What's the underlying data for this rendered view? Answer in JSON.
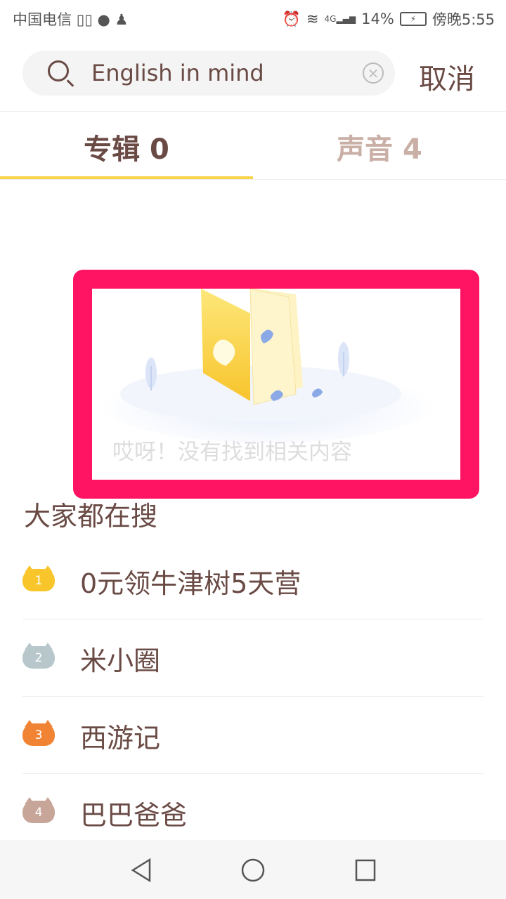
{
  "status_bar": {
    "carrier": "中国电信",
    "app_icons": [
      "ting-icon",
      "cat-icon",
      "qq-penguin-icon"
    ],
    "network": "4G",
    "battery": "14%",
    "time": "傍晚5:55"
  },
  "search": {
    "value": "English in mind",
    "cancel_label": "取消"
  },
  "tabs": [
    {
      "label": "专辑 0",
      "active": true
    },
    {
      "label": "声音 4",
      "active": false
    }
  ],
  "empty_state": {
    "message": "哎呀！没有找到相关内容"
  },
  "hot_searches": {
    "title": "大家都在搜",
    "items": [
      {
        "rank": "1",
        "label": "0元领牛津树5天营",
        "color": "#f8c62a"
      },
      {
        "rank": "2",
        "label": "米小圈",
        "color": "#b7c7cb"
      },
      {
        "rank": "3",
        "label": "西游记",
        "color": "#f08434"
      },
      {
        "rank": "4",
        "label": "巴巴爸爸",
        "color": "#c7a598"
      }
    ]
  },
  "colors": {
    "accent": "#f7d44a",
    "highlight_frame": "#ff1463",
    "text": "#6a4a44",
    "tab_inactive": "#c9afa6"
  }
}
